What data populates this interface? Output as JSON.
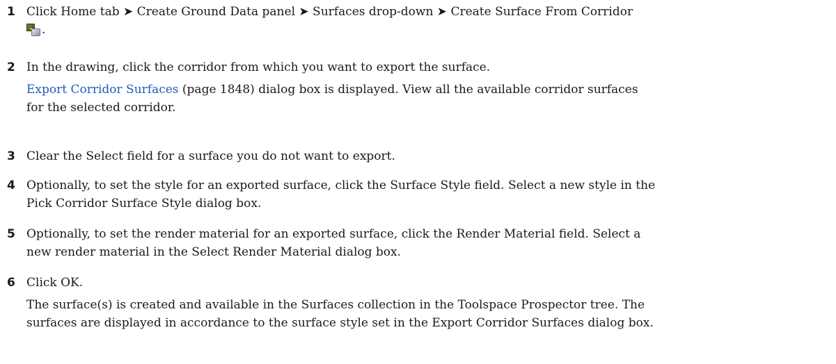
{
  "steps": [
    {
      "number": "1",
      "text_part1": "Click Home tab ➤ Create Ground Data panel ➤ Surfaces drop-down ➤ Create Surface From Corridor",
      "icon": "create-surface-from-corridor-icon",
      "text_part2": "."
    },
    {
      "number": "2",
      "text": "In the drawing, click the corridor from which you want to export the surface.",
      "note": {
        "link": "Export Corridor Surfaces",
        "after_link_line1": "(page 1848) dialog box is displayed. View all the available corridor surfaces",
        "line2": "for the selected corridor."
      }
    },
    {
      "number": "3",
      "text": "Clear the Select field for a surface you do not want to export."
    },
    {
      "number": "4",
      "line1": "Optionally, to set the style for an exported surface, click the Surface Style field. Select a new style in the",
      "line2": "Pick Corridor Surface Style dialog box."
    },
    {
      "number": "5",
      "line1": "Optionally, to set the render material for an exported surface, click the Render Material field. Select a",
      "line2": "new render material in the Select Render Material dialog box."
    },
    {
      "number": "6",
      "text": "Click OK.",
      "note": {
        "line1": "The surface(s) is created and available in the Surfaces collection in the Toolspace Prospector tree. The",
        "line2": "surfaces are displayed in accordance to the surface style set in the Export Corridor Surfaces dialog box."
      }
    }
  ],
  "colors": {
    "link": "#1e5eb8",
    "text": "#1a1a1a"
  }
}
